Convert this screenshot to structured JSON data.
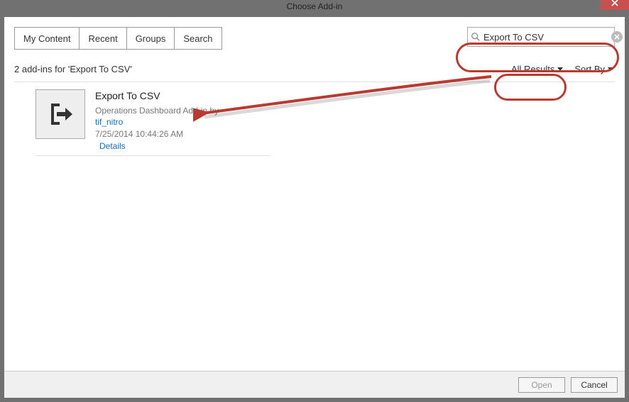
{
  "window": {
    "title": "Choose Add-in"
  },
  "tabs": [
    {
      "label": "My Content"
    },
    {
      "label": "Recent"
    },
    {
      "label": "Groups"
    },
    {
      "label": "Search"
    }
  ],
  "search": {
    "value": "Export To CSV"
  },
  "results_summary": "2 add-ins for 'Export To CSV'",
  "filters": {
    "scope": "All Results",
    "sort": "Sort By"
  },
  "item": {
    "title": "Export To CSV",
    "subtitle": "Operations Dashboard Add-in by",
    "author": "tif_nitro",
    "timestamp": "7/25/2014 10:44:26 AM",
    "details": "Details"
  },
  "buttons": {
    "open": "Open",
    "cancel": "Cancel"
  }
}
